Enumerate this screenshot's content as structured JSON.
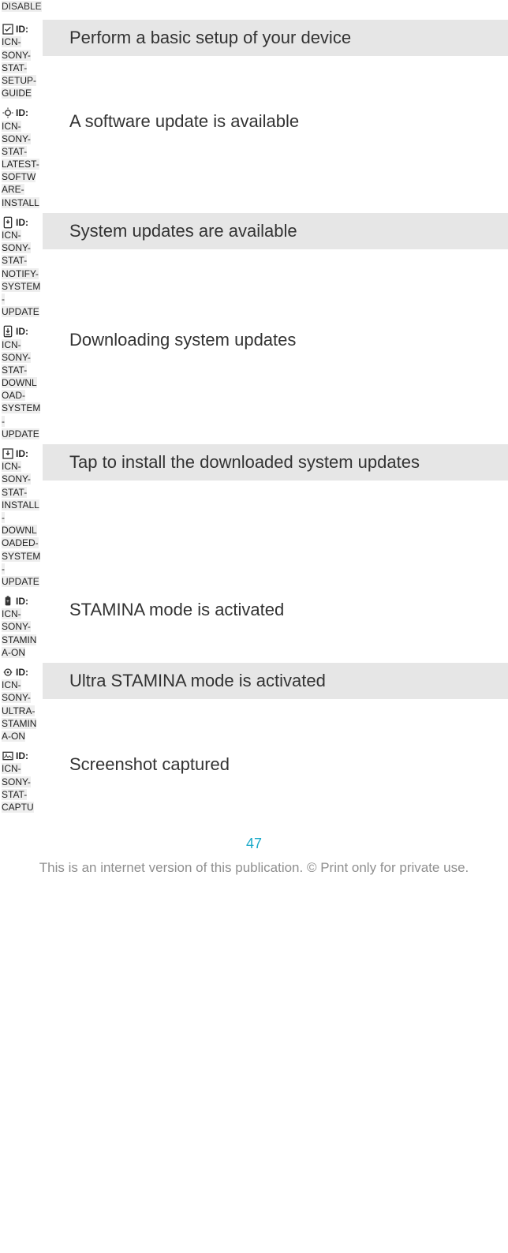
{
  "partial_first_id": "DISABLE",
  "rows": [
    {
      "id_label": "ID:",
      "id": "ICN-SONY-STAT-SETUP-GUIDE",
      "desc": "Perform a basic setup of your device",
      "shaded": true,
      "icon": "check-box-icon"
    },
    {
      "id_label": "ID:",
      "id": "ICN-SONY-STAT-LATEST-SOFTWARE-INSTALL",
      "desc": "A software update is available",
      "shaded": false,
      "icon": "update-sparkle-icon"
    },
    {
      "id_label": "ID:",
      "id": "ICN-SONY-STAT-NOTIFY-SYSTEM-UPDATE",
      "desc": "System updates are available",
      "shaded": true,
      "icon": "system-update-available-icon"
    },
    {
      "id_label": "ID:",
      "id": "ICN-SONY-STAT-DOWNLOAD-SYSTEM-UPDATE",
      "desc": "Downloading system updates",
      "shaded": false,
      "icon": "downloading-update-icon"
    },
    {
      "id_label": "ID:",
      "id": "ICN-SONY-STAT-INSTALL-DOWNLOADED-SYSTEM-UPDATE",
      "desc": "Tap to install the downloaded system updates",
      "shaded": true,
      "icon": "install-downloaded-icon"
    },
    {
      "id_label": "ID:",
      "id": "ICN-SONY-STAMINA-ON",
      "desc": "STAMINA mode is activated",
      "shaded": false,
      "icon": "stamina-icon"
    },
    {
      "id_label": "ID:",
      "id": "ICN-SONY-ULTRA-STAMINA-ON",
      "desc": "Ultra STAMINA mode is activated",
      "shaded": true,
      "icon": "ultra-stamina-icon"
    },
    {
      "id_label": "ID:",
      "id": "ICN-SONY-STAT-CAPTU",
      "desc": "Screenshot captured",
      "shaded": false,
      "icon": "screenshot-icon"
    }
  ],
  "page_number": "47",
  "footer": "This is an internet version of this publication. © Print only for private use."
}
